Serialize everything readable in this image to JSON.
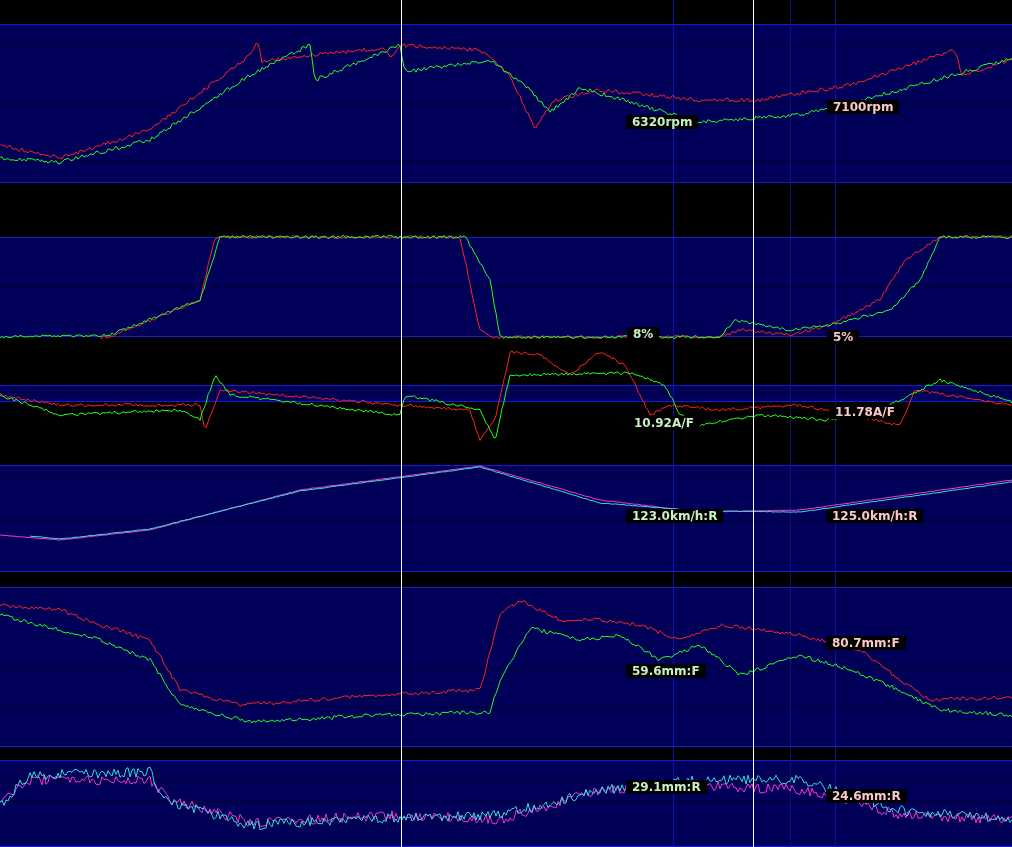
{
  "panels": [
    {
      "readouts": [
        {
          "text": "6320rpm"
        },
        {
          "text": "7100rpm"
        }
      ]
    },
    {
      "readouts": [
        {
          "text": "8%"
        },
        {
          "text": "5%"
        }
      ]
    },
    {
      "readouts": [
        {
          "text": "10.92A/F"
        },
        {
          "text": "11.78A/F"
        }
      ]
    },
    {
      "readouts": [
        {
          "text": "123.0km/h:R"
        },
        {
          "text": "125.0km/h:R"
        }
      ]
    },
    {
      "readouts": [
        {
          "text": "59.6mm:F"
        },
        {
          "text": "80.7mm:F"
        }
      ]
    },
    {
      "readouts": [
        {
          "text": "29.1mm:R"
        },
        {
          "text": "24.6mm:R"
        }
      ]
    }
  ]
}
